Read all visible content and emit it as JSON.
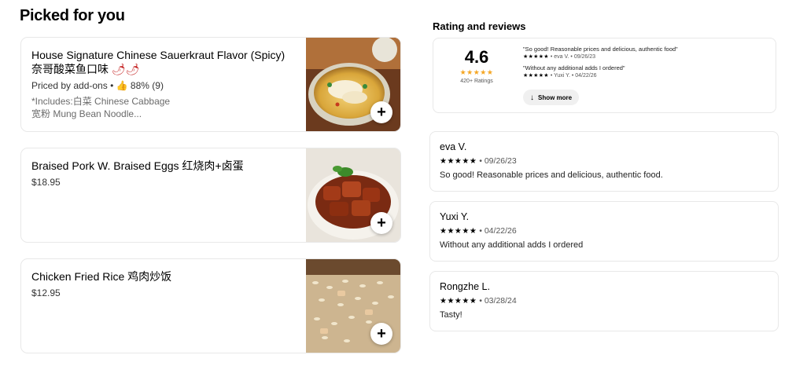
{
  "picked": {
    "title": "Picked for you",
    "items": [
      {
        "name": "House Signature Chinese Sauerkraut Flavor (Spicy) 奈哥酸菜鱼口味",
        "pepper_icon": "chili-pepper-icon",
        "price": "Priced by add-ons",
        "rating_icon": "thumbs-up-icon",
        "rating": "88% (9)",
        "desc_line1": "*Includes:白菜 Chinese Cabbage",
        "desc_line2": "宽粉 Mung Bean Noodle..."
      },
      {
        "name": "Braised Pork W. Braised Eggs 红烧肉+卤蛋",
        "price": "$18.95"
      },
      {
        "name": "Chicken Fried Rice 鸡肉炒饭",
        "price": "$12.95"
      }
    ],
    "add_label": "+"
  },
  "reviews": {
    "title": "Rating and reviews",
    "average": "4.6",
    "stars": "★★★★★",
    "count": "420+ Ratings",
    "mini": [
      {
        "quote": "\"So good! Reasonable prices and delicious, authentic food\"",
        "name": "eva V.",
        "date": "09/26/23"
      },
      {
        "quote": "\"Without any additional adds I ordered\"",
        "name": "Yuxi Y.",
        "date": "04/22/26"
      }
    ],
    "show_more": "Show more",
    "cards": [
      {
        "name": "eva V.",
        "date": "09/26/23",
        "text": "So good! Reasonable prices and delicious, authentic food."
      },
      {
        "name": "Yuxi Y.",
        "date": "04/22/26",
        "text": "Without any additional adds I ordered"
      },
      {
        "name": "Rongzhe L.",
        "date": "03/28/24",
        "text": "Tasty!"
      }
    ]
  },
  "colors": {
    "star_gold": "#f5a623",
    "border": "#e8e8e8",
    "chip_bg": "#f0f0f0"
  }
}
